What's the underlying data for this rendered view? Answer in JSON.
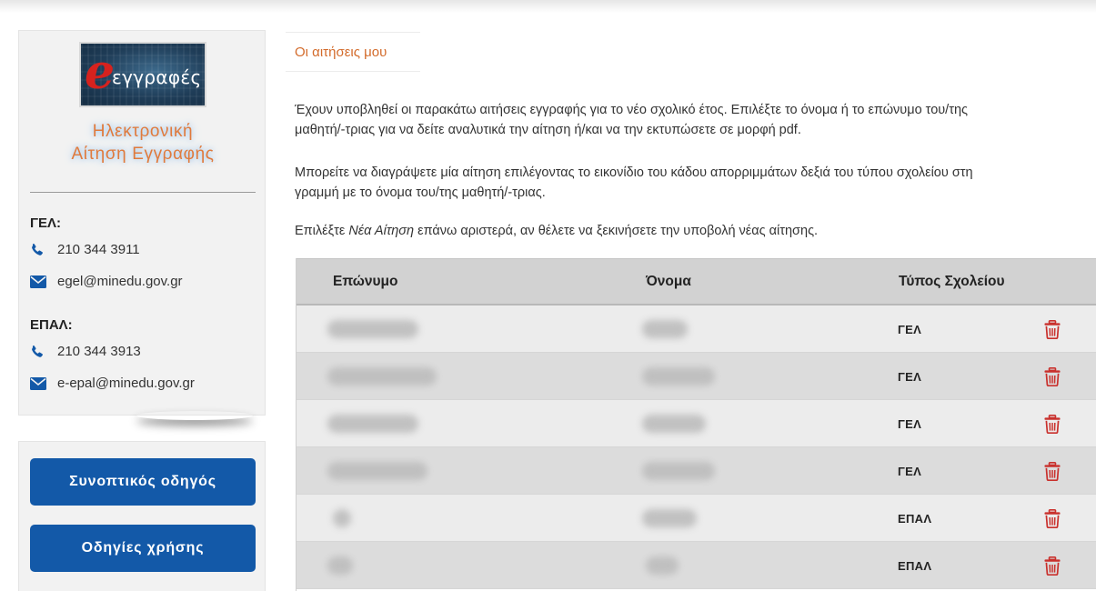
{
  "sidebar": {
    "logo_text": "εγγραφές",
    "app_title_line1": "Ηλεκτρονική",
    "app_title_line2": "Αίτηση Εγγραφής",
    "gel": {
      "heading": "ΓΕΛ:",
      "phone": "210 344 3911",
      "email": "egel@minedu.gov.gr"
    },
    "epal": {
      "heading": "ΕΠΑΛ:",
      "phone": "210 344 3913",
      "email": "e-epal@minedu.gov.gr"
    },
    "buttons": [
      "Συνοπτικός οδηγός",
      "Οδηγίες χρήσης"
    ]
  },
  "main": {
    "tab_label": "Οι αιτήσεις μου",
    "para1_line1": "Έχουν υποβληθεί οι παρακάτω αιτήσεις εγγραφής για το νέο σχολικό έτος. Επιλέξτε το όνομα ή το επώνυμο του/της",
    "para1_line2": "μαθητή/-τριας για να δείτε αναλυτικά την αίτηση ή/και να την εκτυπώσετε σε μορφή pdf.",
    "para2_line1": "Μπορείτε να διαγράψετε μία αίτηση επιλέγοντας το εικονίδιο του κάδου απορριμμάτων δεξιά του τύπου σχολείου στη",
    "para2_line2": "γραμμή με το όνομα του/της μαθητή/-τριας.",
    "para3_before": "Επιλέξτε ",
    "para3_em": "Νέα Αίτηση",
    "para3_after": " επάνω αριστερά, αν θέλετε να ξεκινήσετε την υποβολή νέας αίτησης."
  },
  "table": {
    "headers": [
      "Επώνυμο",
      "Όνομα",
      "Τύπος Σχολείου"
    ],
    "rows": [
      {
        "school_type": "ΓΕΛ"
      },
      {
        "school_type": "ΓΕΛ"
      },
      {
        "school_type": "ΓΕΛ"
      },
      {
        "school_type": "ΓΕΛ"
      },
      {
        "school_type": "ΕΠΑΛ"
      },
      {
        "school_type": "ΕΠΑΛ"
      }
    ]
  },
  "colors": {
    "accent_orange": "#d36b2b",
    "button_blue": "#1359a8",
    "icon_blue": "#1359a8",
    "trash_red": "#c9302c"
  },
  "icons": [
    "phone-icon",
    "envelope-icon",
    "trash-icon"
  ]
}
